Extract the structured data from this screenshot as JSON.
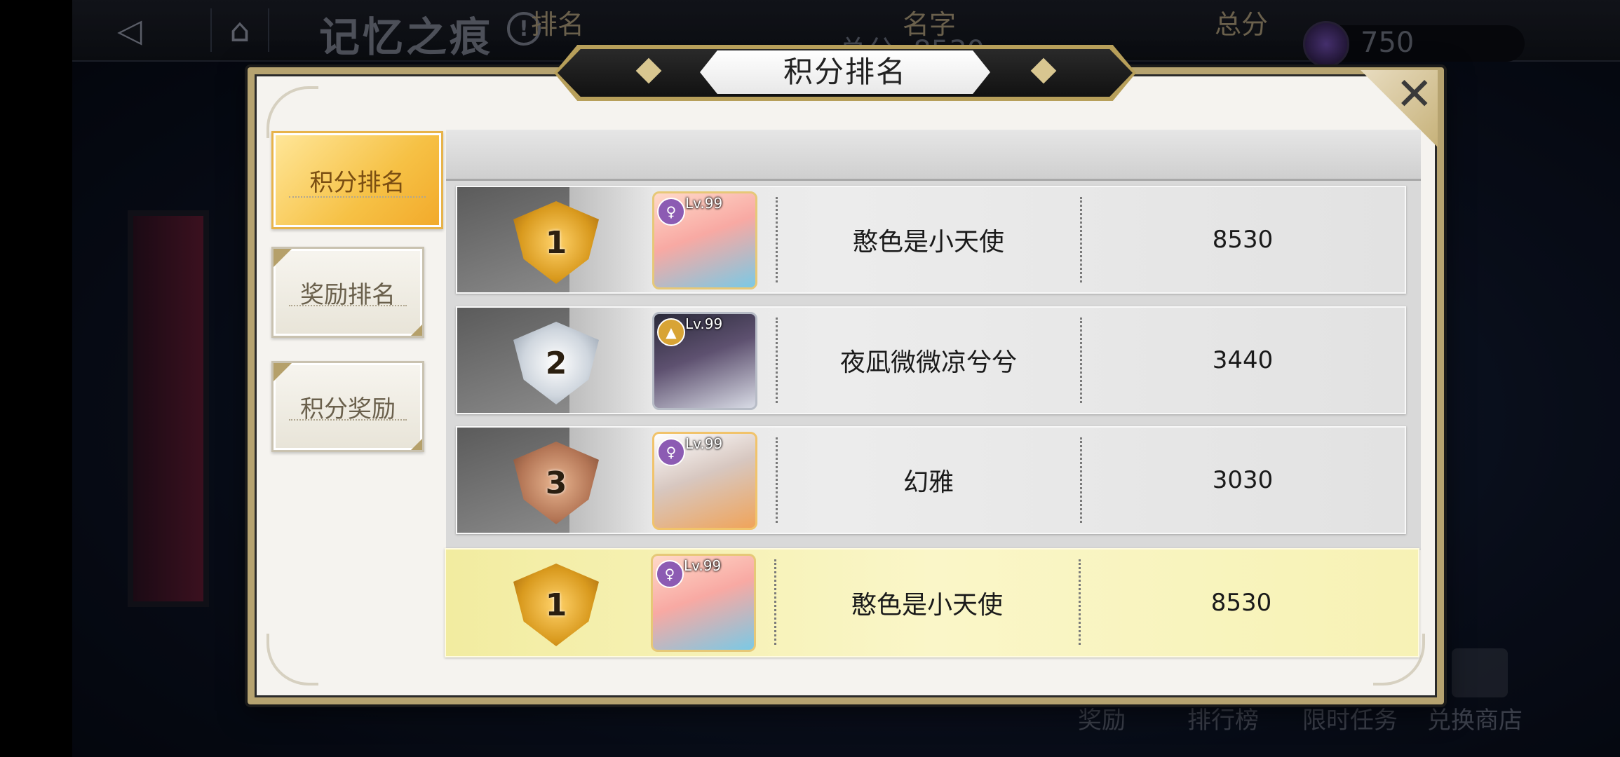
{
  "topbar": {
    "title": "记忆之痕",
    "score_text": "总分: 8530",
    "currency_value": "750"
  },
  "bottom_nav": {
    "reward": "奖励",
    "ranking": "排行榜",
    "timed_task": "限时任务",
    "exchange_shop": "兑换商店"
  },
  "modal": {
    "title": "积分排名",
    "tabs": [
      "积分排名",
      "奖励排名",
      "积分奖励"
    ],
    "active_tab": "积分排名",
    "columns": {
      "rank": "排名",
      "name": "名字",
      "score": "总分"
    },
    "rows": [
      {
        "rank": "1",
        "level": "Lv.99",
        "name": "憨色是小天使",
        "score": "8530",
        "medal": "gold"
      },
      {
        "rank": "2",
        "level": "Lv.99",
        "name": "夜凪微微凉兮兮",
        "score": "3440",
        "medal": "silver"
      },
      {
        "rank": "3",
        "level": "Lv.99",
        "name": "幻雅",
        "score": "3030",
        "medal": "bronze"
      }
    ],
    "self_row": {
      "rank": "1",
      "level": "Lv.99",
      "name": "憨色是小天使",
      "score": "8530",
      "medal": "gold"
    }
  },
  "colors": {
    "gold_trim": "#b6a370",
    "active_tab": "#f6c145",
    "self_row": "#faf6c8"
  }
}
